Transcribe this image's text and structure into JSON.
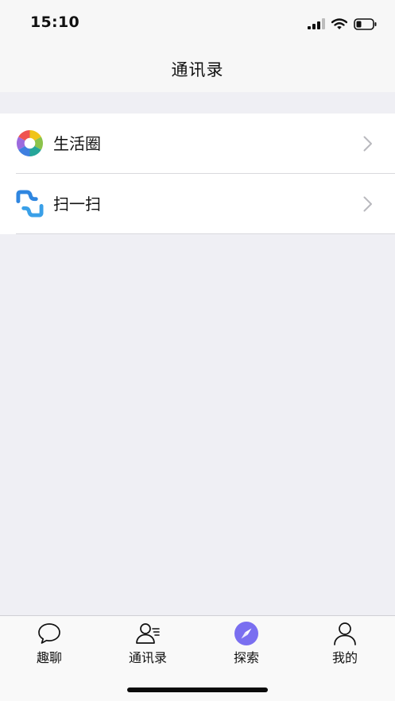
{
  "status_bar": {
    "time": "15:10"
  },
  "header": {
    "title": "通讯录"
  },
  "menu": {
    "items": [
      {
        "label": "生活圈",
        "icon": "aperture-icon"
      },
      {
        "label": "扫一扫",
        "icon": "scan-icon"
      }
    ]
  },
  "tab_bar": {
    "tabs": [
      {
        "label": "趣聊",
        "icon": "chat-bubble-icon"
      },
      {
        "label": "通讯录",
        "icon": "contacts-icon"
      },
      {
        "label": "探索",
        "icon": "compass-icon",
        "active": true
      },
      {
        "label": "我的",
        "icon": "person-icon"
      }
    ]
  },
  "colors": {
    "accent": "#7a6ff0",
    "background": "#efeff4",
    "bar": "#f7f7f7"
  }
}
